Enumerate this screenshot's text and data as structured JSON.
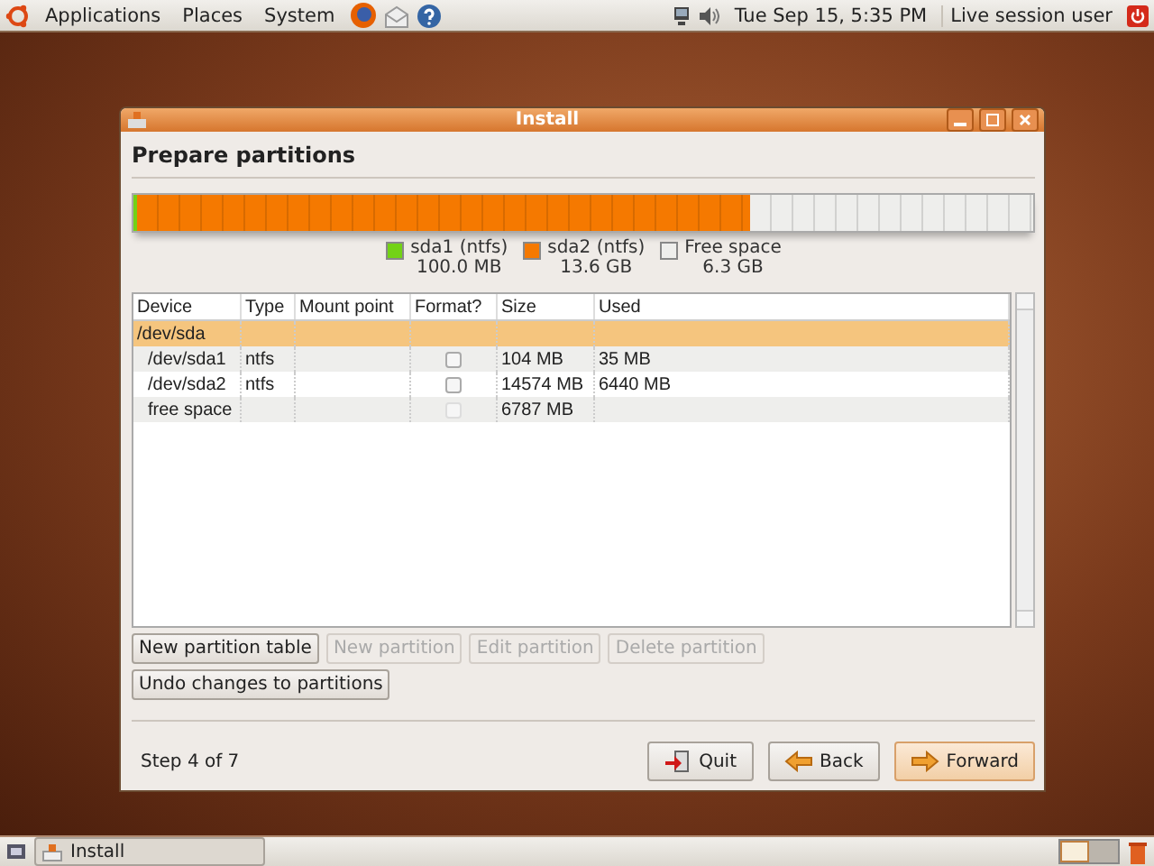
{
  "top_panel": {
    "menus": [
      "Applications",
      "Places",
      "System"
    ],
    "clock": "Tue Sep 15,  5:35 PM",
    "user": "Live session user"
  },
  "window": {
    "title": "Install",
    "heading": "Prepare partitions",
    "disk": [
      {
        "label": "sda1 (ntfs)",
        "size": "100.0 MB",
        "color": "#73d216",
        "level": 0.005
      },
      {
        "label": "sda2 (ntfs)",
        "size": "13.6 GB",
        "color": "#f57900",
        "level": 0.68
      },
      {
        "label": "Free space",
        "size": "6.3 GB",
        "color": "#eeeeec",
        "level": 0.315
      }
    ],
    "table": {
      "columns": [
        "Device",
        "Type",
        "Mount point",
        "Format?",
        "Size",
        "Used"
      ],
      "rows": [
        {
          "device": "/dev/sda",
          "selected": true,
          "children": [
            {
              "device": "/dev/sda1",
              "type": "ntfs",
              "format_checked": false,
              "format_disabled": false,
              "size": "104 MB",
              "used": "35 MB",
              "selected": false
            },
            {
              "device": "/dev/sda2",
              "type": "ntfs",
              "format_checked": false,
              "format_disabled": false,
              "size": "14574 MB",
              "used": "6440 MB",
              "selected": false
            },
            {
              "device": "free space",
              "format_checked": false,
              "format_disabled": true,
              "size": "6787 MB",
              "selected": false
            }
          ]
        }
      ]
    },
    "partition_buttons": [
      {
        "label": "New partition table",
        "disabled": false
      },
      {
        "label": "New partition",
        "disabled": true
      },
      {
        "label": "Edit partition",
        "disabled": true
      },
      {
        "label": "Delete partition",
        "disabled": true
      }
    ],
    "undo_button": {
      "label": "Undo changes to partitions",
      "disabled": false
    },
    "step": "Step 4 of 7",
    "nav_buttons": [
      {
        "label": "Quit",
        "kind": "quit",
        "default": false
      },
      {
        "label": "Back",
        "kind": "back",
        "default": false
      },
      {
        "label": "Forward",
        "kind": "forward",
        "default": true
      }
    ]
  },
  "bottom_panel": {
    "task": "Install",
    "workspaces": [
      {
        "selected": true
      },
      {
        "selected": false
      }
    ]
  }
}
